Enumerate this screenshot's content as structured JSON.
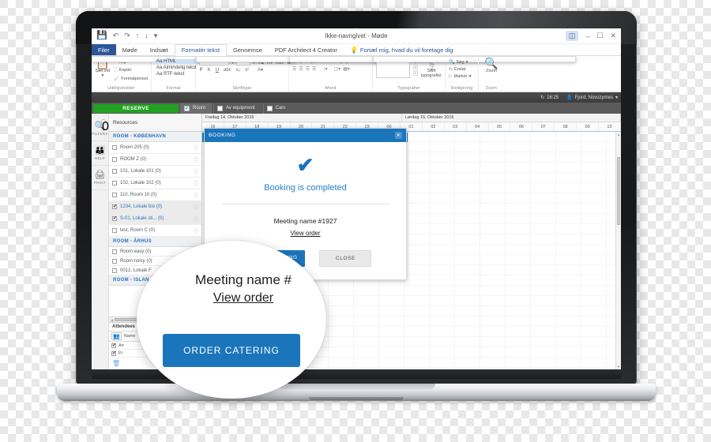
{
  "window": {
    "title": "Ikke-navngivet - Møde",
    "quick_access": [
      "save-icon",
      "undo-icon",
      "redo-icon",
      "up-icon",
      "down-icon",
      "more-icon"
    ],
    "controls": [
      "ribbon-options-icon",
      "minimize-icon",
      "restore-icon",
      "close-icon"
    ]
  },
  "ribbon": {
    "tabs": [
      {
        "label": "Filer",
        "state": "file"
      },
      {
        "label": "Møde",
        "state": "normal"
      },
      {
        "label": "Indsæt",
        "state": "normal"
      },
      {
        "label": "Formatér tekst",
        "state": "active"
      },
      {
        "label": "Gennemse",
        "state": "normal"
      },
      {
        "label": "PDF Architect 4 Creator",
        "state": "normal"
      }
    ],
    "tell_me": "Fortæl mig, hvad du vil foretage dig",
    "groups": [
      {
        "label": "Udklipsholder",
        "big_button": {
          "label": "Sæt ind",
          "icon": "paste-icon"
        },
        "items": [
          {
            "label": "Klip",
            "icon": "scissors-icon"
          },
          {
            "label": "Kopiér",
            "icon": "copy-icon"
          },
          {
            "label": "Formatpensel",
            "icon": "format-painter-icon"
          }
        ]
      },
      {
        "label": "Format",
        "options": [
          {
            "label": "Aa HTML",
            "selected": true
          },
          {
            "label": "Aa Almindelig tekst",
            "selected": false
          },
          {
            "label": "Aa RTF-tekst",
            "selected": false
          }
        ]
      },
      {
        "label": "Skrifttype",
        "buttons": [
          "bold-F",
          "italic-K",
          "underline-U",
          "strikethrough",
          "subscript",
          "superscript",
          "font-color-A",
          "grow-font",
          "shrink-font",
          "change-case",
          "clear-formatting"
        ]
      },
      {
        "label": "Afsnit",
        "buttons": [
          "bullets-icon",
          "numbering-icon",
          "multilevel-icon",
          "decrease-indent-icon",
          "increase-indent-icon",
          "sort-icon",
          "show-marks-icon",
          "align-left-icon",
          "align-center-icon",
          "align-right-icon",
          "justify-icon",
          "line-spacing-icon",
          "shading-icon",
          "borders-icon"
        ]
      },
      {
        "label": "Typografier",
        "big_button": {
          "label": "Skift typografier",
          "icon": "styles-icon"
        }
      },
      {
        "label": "Redigering",
        "items": [
          {
            "label": "Søg",
            "icon": "search-icon"
          },
          {
            "label": "Erstat",
            "icon": "replace-icon"
          },
          {
            "label": "Markér",
            "icon": "select-icon"
          }
        ]
      },
      {
        "label": "Zoom",
        "big_button": {
          "label": "Zoom",
          "icon": "zoom-icon"
        }
      }
    ]
  },
  "appbar": {
    "time": "16:25",
    "time_icon": "refresh-icon",
    "user": "Fjord, Novozymes",
    "user_icon": "person-icon",
    "chevron": "chevron-down-icon"
  },
  "toolstrip": {
    "reserve_label": "RESERVE",
    "reserve_color": "#21a121",
    "filters": [
      {
        "label": "Room",
        "checked": true
      },
      {
        "label": "Av equipment",
        "checked": false
      },
      {
        "label": "Cars",
        "checked": false
      }
    ]
  },
  "rail": {
    "items": [
      {
        "label": "FILTERS",
        "icon": "filter-search-icon",
        "badge": "0"
      },
      {
        "label": "HELP",
        "icon": "help-person-icon",
        "badge": ""
      },
      {
        "label": "PRINT",
        "icon": "printer-icon",
        "badge": ""
      }
    ],
    "vertical_label": "FILTERS"
  },
  "resources": {
    "header": "Resources",
    "groups": [
      {
        "name": "ROOM - KØBENHAVN",
        "rows": [
          {
            "label": "Room 205 (0)",
            "checked": false,
            "selected": false
          },
          {
            "label": "ROOM Z (0)",
            "checked": false,
            "selected": false
          },
          {
            "label": "101, Lokale 101 (0)",
            "checked": false,
            "selected": false
          },
          {
            "label": "102, Lokale 102 (0)",
            "checked": false,
            "selected": false
          },
          {
            "label": "110, Room 10 (0)",
            "checked": false,
            "selected": false
          },
          {
            "label": "1234, Lokale bio (0)",
            "checked": true,
            "selected": true
          },
          {
            "label": "S-01, Lokale sti... (0)",
            "checked": true,
            "selected": true
          },
          {
            "label": "test, Room C (0)",
            "checked": false,
            "selected": false
          }
        ]
      },
      {
        "name": "ROOM - ÅRHUS",
        "rows": [
          {
            "label": "Room easy (0)",
            "checked": false,
            "selected": false
          },
          {
            "label": "Room noisy (0)",
            "checked": false,
            "selected": false
          },
          {
            "label": "0012, Lokale F",
            "checked": false,
            "selected": false
          }
        ]
      },
      {
        "name": "ROOM - ISLAN",
        "rows": []
      }
    ],
    "attendees": {
      "title": "Attendees",
      "add_icon": "add-attendee-icon",
      "column": "Name",
      "rows": [
        {
          "label": "An",
          "checked": true
        },
        {
          "label": "Pi",
          "checked": true
        }
      ],
      "delete_icon": "trash-icon"
    }
  },
  "timeline": {
    "days": [
      {
        "label": "Fredag 14, Oktober 2016",
        "hours": [
          "16",
          "17",
          "18",
          "19",
          "20",
          "21",
          "22",
          "23"
        ]
      },
      {
        "label": "Lørdag 15, Oktober 2016",
        "hours": [
          "00",
          "01",
          "02",
          "03",
          "04",
          "05",
          "06",
          "07",
          "08",
          "09",
          "10"
        ]
      }
    ]
  },
  "dialog": {
    "title": "BOOKING",
    "close_icon": "close-icon",
    "check_icon": "checkmark-icon",
    "message": "Booking is completed",
    "meeting_name": "Meeting name #1927",
    "view_order": "View order",
    "primary_button": "ORDER CATERING",
    "secondary_button": "CLOSE",
    "accent_color": "#1b75bb"
  },
  "magnifier": {
    "meeting_name": "Meeting name #",
    "view_order": "View order",
    "button": "ORDER CATERING"
  }
}
